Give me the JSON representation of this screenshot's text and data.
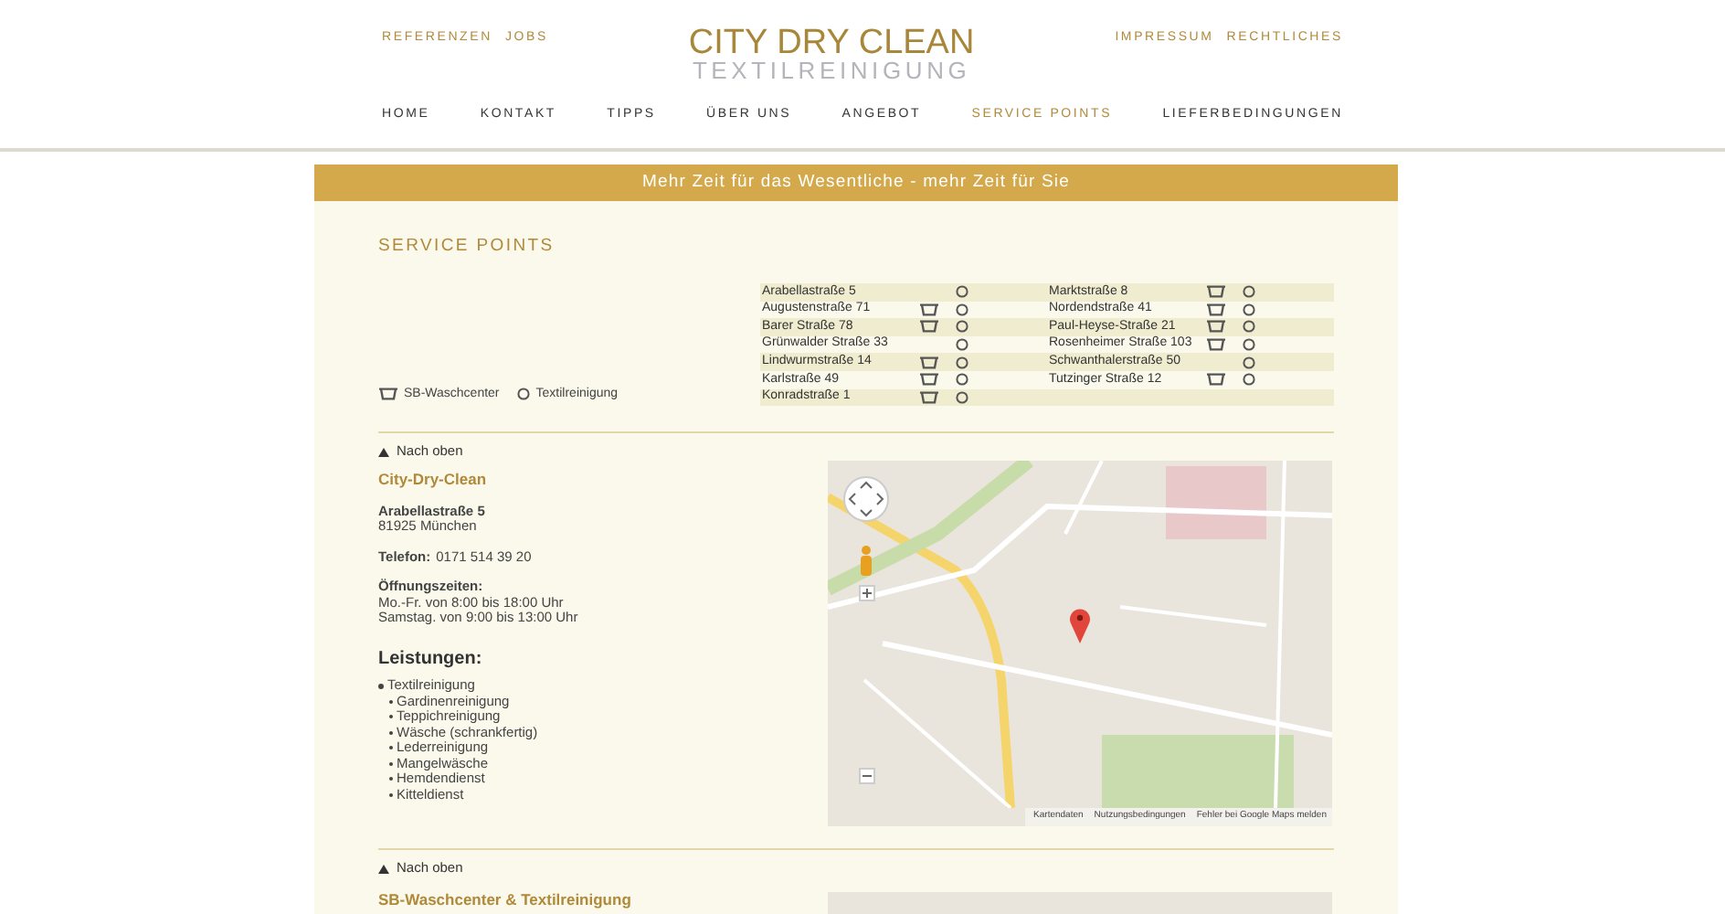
{
  "top_links_left": [
    "REFERENZEN",
    "JOBS"
  ],
  "logo": {
    "title": "CITY DRY CLEAN",
    "subtitle": "TEXTILREINIGUNG"
  },
  "top_links_right": [
    "IMPRESSUM",
    "RECHTLICHES"
  ],
  "nav": [
    {
      "label": "HOME",
      "selected": false
    },
    {
      "label": "KONTAKT",
      "selected": false
    },
    {
      "label": "TIPPS",
      "selected": false
    },
    {
      "label": "ÜBER UNS",
      "selected": false
    },
    {
      "label": "ANGEBOT",
      "selected": false
    },
    {
      "label": "SERVICE POINTS",
      "selected": true
    },
    {
      "label": "LIEFERBEDINGUNGEN",
      "selected": false
    }
  ],
  "banner": "Mehr Zeit für das Wesentliche - mehr Zeit für Sie",
  "section_title": "SERVICE POINTS",
  "legend": [
    {
      "kind": "washer",
      "label": "SB-Waschcenter"
    },
    {
      "kind": "circle",
      "label": "Textilreinigung"
    }
  ],
  "locations": [
    [
      {
        "name": "Arabellastraße 5",
        "sb_waschcenter": false,
        "textilreinigung": true
      },
      {
        "name": "Augustenstraße 71",
        "sb_waschcenter": true,
        "textilreinigung": true
      },
      {
        "name": "Barer Straße 78",
        "sb_waschcenter": true,
        "textilreinigung": true
      },
      {
        "name": "Grünwalder Straße 33",
        "sb_waschcenter": false,
        "textilreinigung": true
      },
      {
        "name": "Lindwurmstraße 14",
        "sb_waschcenter": true,
        "textilreinigung": true
      },
      {
        "name": "Karlstraße 49",
        "sb_waschcenter": true,
        "textilreinigung": true
      },
      {
        "name": "Konradstraße 1",
        "sb_waschcenter": true,
        "textilreinigung": true
      }
    ],
    [
      {
        "name": "Marktstraße 8",
        "sb_waschcenter": true,
        "textilreinigung": true
      },
      {
        "name": "Nordendstraße 41",
        "sb_waschcenter": true,
        "textilreinigung": true
      },
      {
        "name": "Paul-Heyse-Straße 21",
        "sb_waschcenter": true,
        "textilreinigung": true
      },
      {
        "name": "Rosenheimer Straße 103",
        "sb_waschcenter": true,
        "textilreinigung": true
      },
      {
        "name": "Schwanthalerstraße 50",
        "sb_waschcenter": false,
        "textilreinigung": true
      },
      {
        "name": "Tutzinger Straße 12",
        "sb_waschcenter": true,
        "textilreinigung": true
      }
    ]
  ],
  "back_to_top": [
    "Nach oben",
    "Nach oben"
  ],
  "store": {
    "name": "City-Dry-Clean",
    "street": "Arabellastraße 5",
    "city": "81925 München",
    "phone_label": "Telefon:",
    "phone": "0171 514 39 20",
    "hours_label": "Öffnungszeiten:",
    "hours": [
      "Mo.-Fr. von 8:00 bis 18:00 Uhr",
      "Samstag. von 9:00 bis 13:00 Uhr"
    ],
    "services_title": "Leistungen:",
    "services": [
      {
        "label": "Textilreinigung",
        "children": [
          {
            "label": "Gardinenreinigung"
          },
          {
            "label": "Teppichreinigung"
          },
          {
            "label": "Wäsche (schrankfertig)"
          },
          {
            "label": "Lederreinigung"
          },
          {
            "label": "Mangelwäsche"
          },
          {
            "label": "Hemdendienst"
          },
          {
            "label": "Kitteldienst"
          }
        ]
      }
    ]
  },
  "map": {
    "attribution": [
      "Kartendaten",
      "Nutzungsbedingungen",
      "Fehler bei Google Maps melden"
    ]
  },
  "next_store": {
    "name": "SB-Waschcenter & Textilreinigung"
  }
}
